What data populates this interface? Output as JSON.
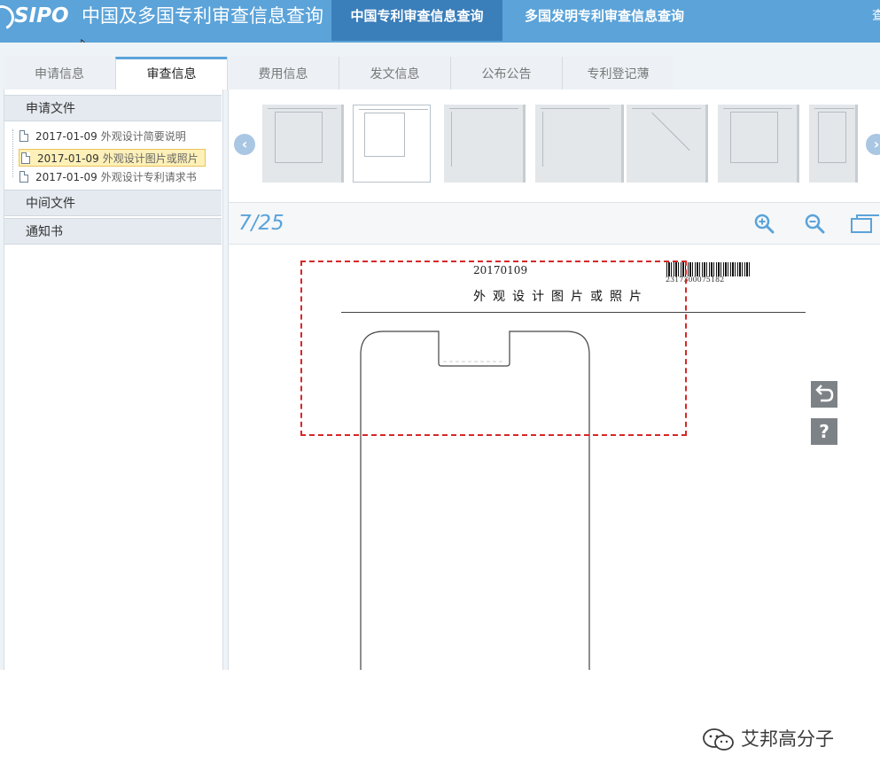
{
  "header": {
    "logo": "SIPO",
    "site_title": "中国及多国专利审查信息查询",
    "nav": [
      {
        "label": "中国专利审查信息查询",
        "active": true
      },
      {
        "label": "多国发明专利审查信息查询",
        "active": false
      }
    ],
    "nav_overflow": "查"
  },
  "tabs": [
    {
      "label": "申请信息",
      "active": false
    },
    {
      "label": "审查信息",
      "active": true
    },
    {
      "label": "费用信息",
      "active": false
    },
    {
      "label": "发文信息",
      "active": false
    },
    {
      "label": "公布公告",
      "active": false
    },
    {
      "label": "专利登记薄",
      "active": false
    }
  ],
  "sidebar": {
    "groups": [
      {
        "title": "申请文件",
        "items": [
          {
            "date": "2017-01-09",
            "name": "外观设计简要说明",
            "selected": false
          },
          {
            "date": "2017-01-09",
            "name": "外观设计图片或照片",
            "selected": true
          },
          {
            "date": "2017-01-09",
            "name": "外观设计专利请求书",
            "selected": false
          }
        ]
      },
      {
        "title": "中间文件",
        "items": []
      },
      {
        "title": "通知书",
        "items": []
      }
    ]
  },
  "viewer": {
    "page_counter": "7/25",
    "current_page": 7,
    "total_pages": 25,
    "document": {
      "date": "20170109",
      "barcode_number": "2317300075182",
      "title": "外观设计图片或照片"
    }
  },
  "watermark": "艾邦高分子",
  "colors": {
    "header": "#5ba3d9",
    "nav_active": "#3a7eba",
    "highlight": "#fdf0b8",
    "annotation": "#d62828"
  }
}
